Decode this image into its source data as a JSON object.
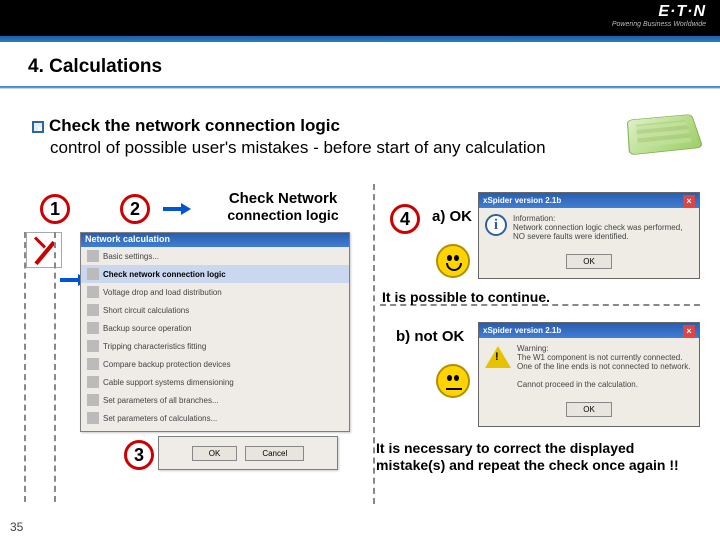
{
  "header": {
    "brand": "E·T·N",
    "tagline": "Powering Business Worldwide"
  },
  "title": "4. Calculations",
  "bullet": {
    "main": "Check the network connection logic",
    "sub": "control of possible user's mistakes - before start of any calculation"
  },
  "steps": {
    "s1": "1",
    "s2": "2",
    "s3": "3",
    "s4": "4"
  },
  "check_label": {
    "l1": "Check Network",
    "l2": "connection logic"
  },
  "menu": {
    "title": "Network calculation",
    "items": [
      "Basic settings...",
      "Check network connection logic",
      "Voltage drop and load distribution",
      "Short circuit calculations",
      "Backup source operation",
      "Tripping characteristics fitting",
      "Compare backup protection devices",
      "Cable support systems dimensioning",
      "Set parameters of all branches...",
      "Set parameters of calculations..."
    ],
    "selected_index": 1
  },
  "dlg3": {
    "ok": "OK",
    "cancel": "Cancel"
  },
  "result_a": "a) OK",
  "result_b": "b) not OK",
  "msg_ok": {
    "title": "xSpider version 2.1b",
    "text": "Information:\nNetwork connection logic check was performed,\nNO severe faults were identified.",
    "button": "OK"
  },
  "msg_err": {
    "title": "xSpider version 2.1b",
    "text": "Warning:\nThe W1 component is not currently connected.\nOne of the line ends is not connected to network.\n\nCannot proceed in the calculation.",
    "button": "OK"
  },
  "followup_ok": "It is possible to continue.",
  "followup_err": "It is necessary to correct the displayed mistake(s) and repeat the check once again !!",
  "page": "35"
}
